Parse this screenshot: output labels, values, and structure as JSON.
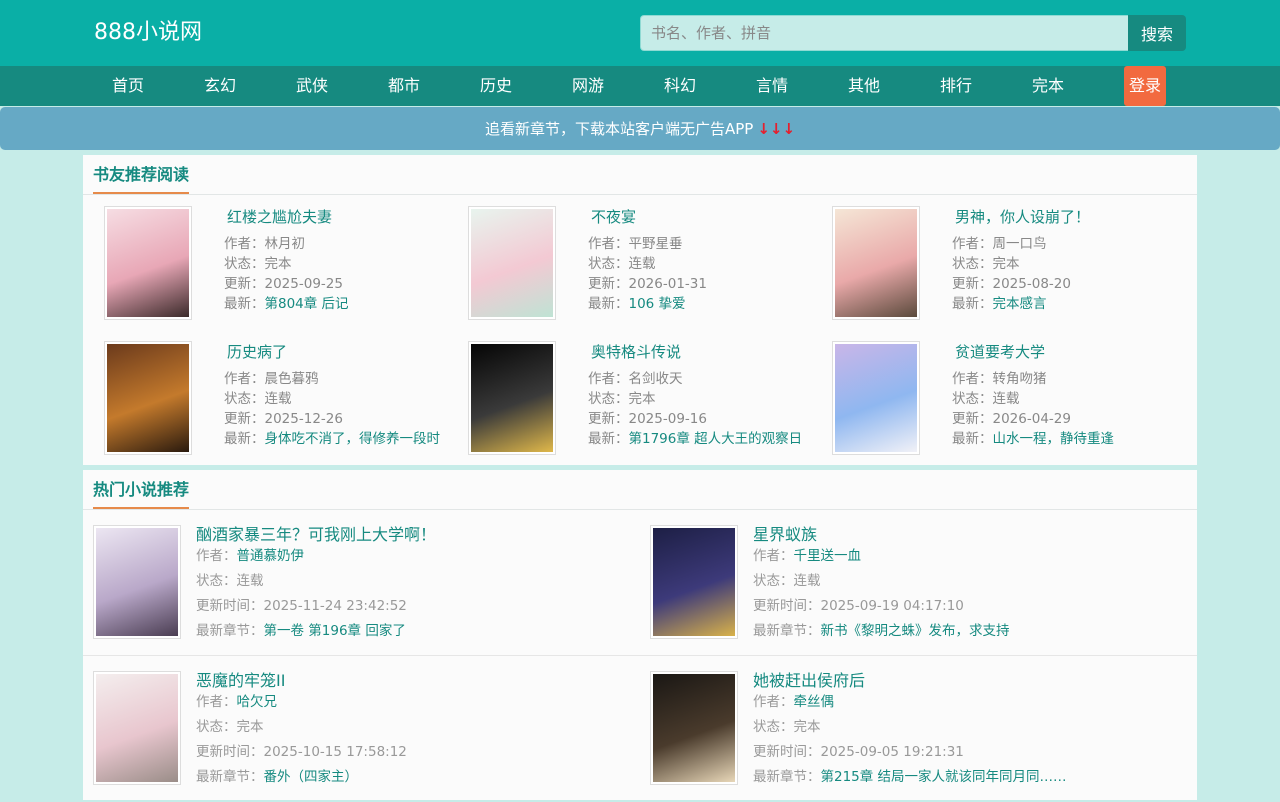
{
  "site": {
    "logo": "888小说网"
  },
  "search": {
    "placeholder": "书名、作者、拼音",
    "button": "搜索"
  },
  "nav": {
    "items": [
      "首页",
      "玄幻",
      "武侠",
      "都市",
      "历史",
      "网游",
      "科幻",
      "言情",
      "其他",
      "排行",
      "完本"
    ],
    "login": "登录"
  },
  "notice": {
    "text": "追看新章节，下载本站客户端无广告APP",
    "arrows": "↓↓↓"
  },
  "labels": {
    "author": "作者：",
    "status": "状态：",
    "updated": "更新：",
    "latest": "最新：",
    "update_time": "更新时间：",
    "latest_chapter": "最新章节："
  },
  "recommend": {
    "title": "书友推荐阅读",
    "books": [
      {
        "title": "红楼之尴尬夫妻",
        "author": "林月初",
        "status": "完本",
        "updated": "2025-09-25",
        "latest": "第804章 后记",
        "cover_colors": [
          "#f6dde3",
          "#e8a7b6",
          "#3b2a2a"
        ]
      },
      {
        "title": "不夜宴",
        "author": "平野星垂",
        "status": "连载",
        "updated": "2026-01-31",
        "latest": "106 挚爱",
        "cover_colors": [
          "#e8f4ee",
          "#f3c9d3",
          "#bfe3d4"
        ]
      },
      {
        "title": "男神，你人设崩了！",
        "author": "周一口鸟",
        "status": "完本",
        "updated": "2025-08-20",
        "latest": "完本感言",
        "cover_colors": [
          "#f5e6d6",
          "#e9a9a9",
          "#5b4a3c"
        ]
      },
      {
        "title": "历史病了",
        "author": "晨色暮鸦",
        "status": "连载",
        "updated": "2025-12-26",
        "latest": "身体吃不消了，得修养一段时",
        "cover_colors": [
          "#6b3a1c",
          "#c47a2c",
          "#2a1a0e"
        ]
      },
      {
        "title": "奥特格斗传说",
        "author": "名剑收天",
        "status": "完本",
        "updated": "2025-09-16",
        "latest": "第1796章 超人大王的观察日",
        "cover_colors": [
          "#050505",
          "#3a3a3a",
          "#e0b84a"
        ]
      },
      {
        "title": "贫道要考大学",
        "author": "转角吻猪",
        "status": "连载",
        "updated": "2026-04-29",
        "latest": "山水一程，静待重逢",
        "cover_colors": [
          "#c9b6e8",
          "#8fb7f0",
          "#f1f1f7"
        ]
      }
    ]
  },
  "hot": {
    "title": "热门小说推荐",
    "books": [
      {
        "title": "酗酒家暴三年？可我刚上大学啊！",
        "author": "普通慕奶伊",
        "status": "连载",
        "updated": "2025-11-24 23:42:52",
        "latest": "第一卷 第196章 回家了",
        "cover_colors": [
          "#ece6f2",
          "#b9a8c9",
          "#4a3d52"
        ]
      },
      {
        "title": "星界蚁族",
        "author": "千里送一血",
        "status": "连载",
        "updated": "2025-09-19 04:17:10",
        "latest": "新书《黎明之蛛》发布，求支持",
        "cover_colors": [
          "#1d1f45",
          "#3d3a7a",
          "#d9b24a"
        ]
      },
      {
        "title": "恶魔的牢笼II",
        "author": "哈欠兄",
        "status": "完本",
        "updated": "2025-10-15 17:58:12",
        "latest": "番外（四家主）",
        "cover_colors": [
          "#f4eeee",
          "#e8c6ce",
          "#9a8d88"
        ]
      },
      {
        "title": "她被赶出侯府后",
        "author": "牵丝偶",
        "status": "完本",
        "updated": "2025-09-05 19:21:31",
        "latest": "第215章 结局一家人就该同年同月同……",
        "cover_colors": [
          "#1a1714",
          "#4a3b2c",
          "#e8d7b8"
        ]
      }
    ]
  }
}
